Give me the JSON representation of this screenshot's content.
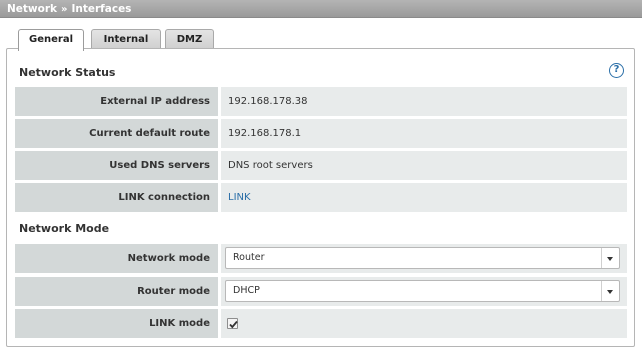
{
  "breadcrumb": {
    "part1": "Network",
    "separator": "»",
    "part2": "Interfaces"
  },
  "tabs": [
    {
      "label": "General",
      "active": true
    },
    {
      "label": "Internal",
      "active": false
    },
    {
      "label": "DMZ",
      "active": false
    }
  ],
  "network_status": {
    "title": "Network Status",
    "help_icon": "?",
    "rows": [
      {
        "label": "External IP address",
        "value": "192.168.178.38"
      },
      {
        "label": "Current default route",
        "value": "192.168.178.1"
      },
      {
        "label": "Used DNS servers",
        "value": "DNS root servers"
      },
      {
        "label": "LINK connection",
        "value": "LINK"
      }
    ]
  },
  "network_mode": {
    "title": "Network Mode",
    "rows": [
      {
        "label": "Network mode",
        "value": "Router"
      },
      {
        "label": "Router mode",
        "value": "DHCP"
      },
      {
        "label": "LINK mode",
        "checked": true
      }
    ]
  },
  "colors": {
    "link": "#2b6fa8",
    "label_bg": "#d3d8d8",
    "value_bg": "#e8ebeb",
    "titlebar": "#a6a6a6"
  }
}
